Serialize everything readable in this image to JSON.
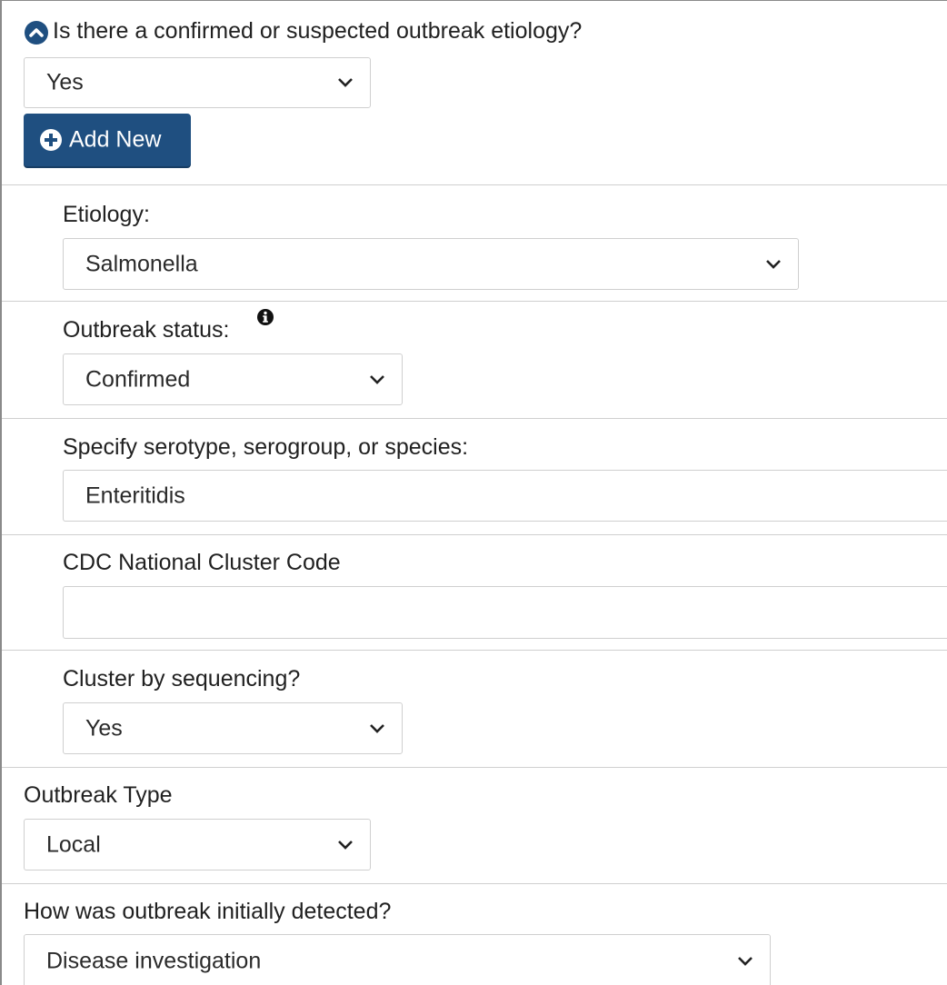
{
  "question": {
    "label": "Is there a confirmed or suspected outbreak etiology?",
    "value": "Yes"
  },
  "add_button": {
    "label": "Add New"
  },
  "etiology_group": {
    "etiology": {
      "label": "Etiology:",
      "value": "Salmonella"
    },
    "outbreak_status": {
      "label": "Outbreak status:",
      "value": "Confirmed"
    },
    "serotype": {
      "label": "Specify serotype, serogroup, or species:",
      "value": "Enteritidis"
    },
    "cluster_code": {
      "label": "CDC National Cluster Code",
      "value": ""
    },
    "cluster_sequencing": {
      "label": "Cluster by sequencing?",
      "value": "Yes"
    }
  },
  "outbreak_type": {
    "label": "Outbreak Type",
    "value": "Local"
  },
  "detection": {
    "label": "How was outbreak initially detected?",
    "value": "Disease investigation"
  },
  "colors": {
    "primary": "#1f4f80",
    "border": "#cfcfcf",
    "text": "#212121"
  }
}
